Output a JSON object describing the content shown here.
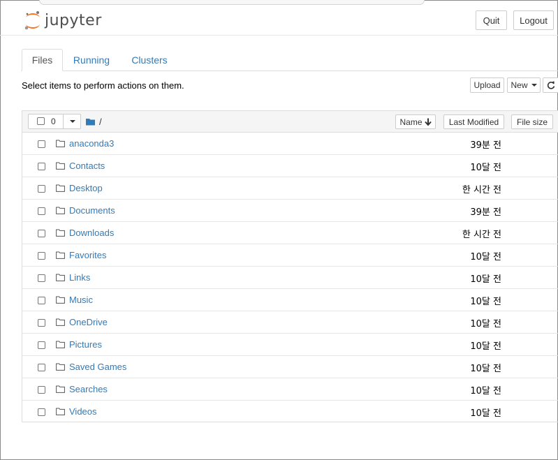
{
  "header": {
    "logo_text": "jupyter",
    "quit_label": "Quit",
    "logout_label": "Logout"
  },
  "tabs": [
    {
      "label": "Files"
    },
    {
      "label": "Running"
    },
    {
      "label": "Clusters"
    }
  ],
  "toolbar": {
    "instructions": "Select items to perform actions on them.",
    "upload_label": "Upload",
    "new_label": "New"
  },
  "list_header": {
    "selected_count": "0",
    "breadcrumb": "/",
    "sort_name_label": "Name",
    "sort_modified_label": "Last Modified",
    "sort_size_label": "File size"
  },
  "items": [
    {
      "name": "anaconda3",
      "modified": "39분 전"
    },
    {
      "name": "Contacts",
      "modified": "10달 전"
    },
    {
      "name": "Desktop",
      "modified": "한 시간 전"
    },
    {
      "name": "Documents",
      "modified": "39분 전"
    },
    {
      "name": "Downloads",
      "modified": "한 시간 전"
    },
    {
      "name": "Favorites",
      "modified": "10달 전"
    },
    {
      "name": "Links",
      "modified": "10달 전"
    },
    {
      "name": "Music",
      "modified": "10달 전"
    },
    {
      "name": "OneDrive",
      "modified": "10달 전"
    },
    {
      "name": "Pictures",
      "modified": "10달 전"
    },
    {
      "name": "Saved Games",
      "modified": "10달 전"
    },
    {
      "name": "Searches",
      "modified": "10달 전"
    },
    {
      "name": "Videos",
      "modified": "10달 전"
    }
  ],
  "colors": {
    "link": "#337ab7",
    "logo_orange": "#f37726"
  }
}
